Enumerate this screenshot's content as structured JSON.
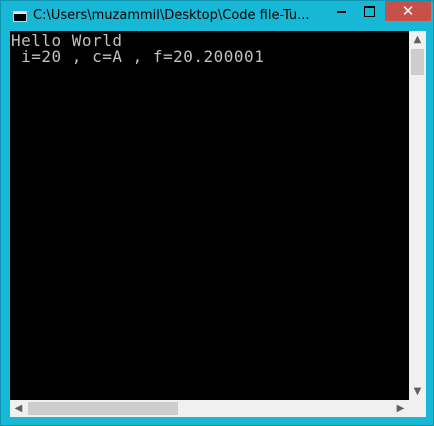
{
  "window": {
    "title": "C:\\Users\\muzammil\\Desktop\\Code file-Tu...",
    "controls": {
      "minimize_icon": "minimize-icon",
      "maximize_icon": "maximize-icon",
      "close_label": "✕"
    },
    "accent_color": "#16b8d6",
    "close_color": "#c7504a"
  },
  "console": {
    "background": "#000000",
    "text_color": "#c0c0c0",
    "lines": [
      "Hello World",
      " i=20 , c=A , f=20.200001"
    ]
  },
  "scrollbars": {
    "up_arrow": "▲",
    "down_arrow": "▼",
    "left_arrow": "◀",
    "right_arrow": "▶"
  }
}
